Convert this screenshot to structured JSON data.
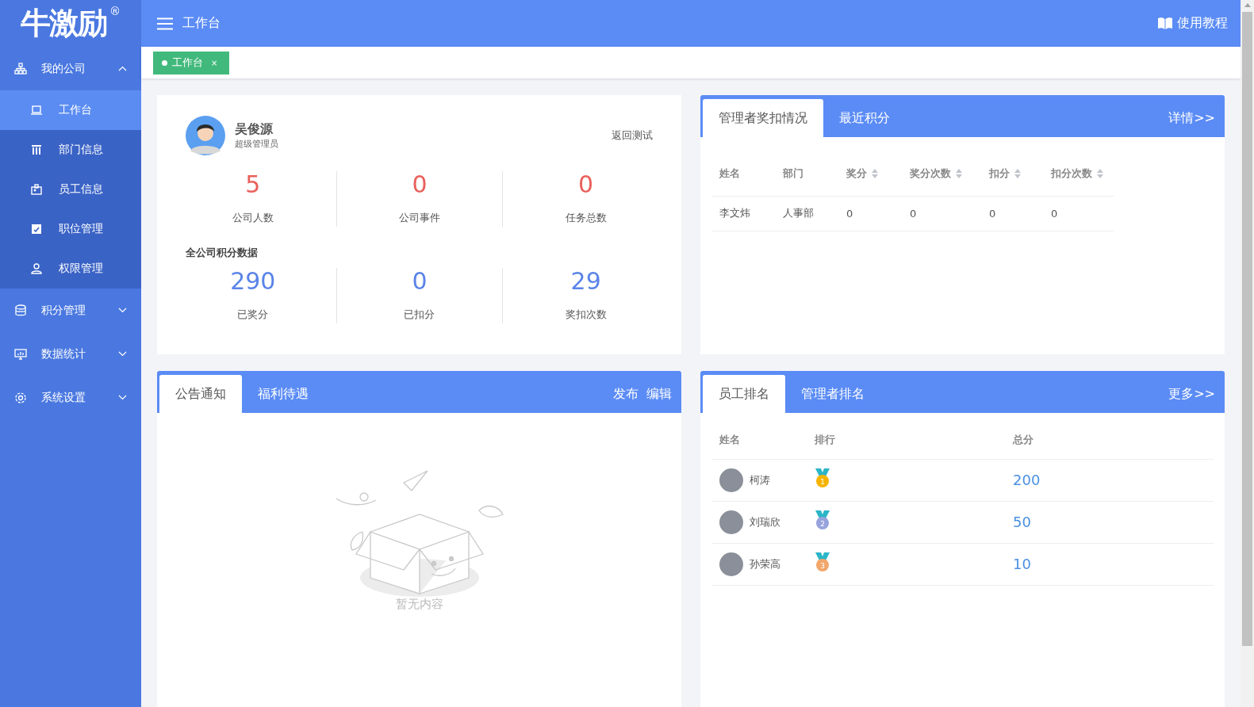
{
  "logo": {
    "text": "牛激励",
    "mark": "®"
  },
  "header": {
    "title": "工作台",
    "help": "使用教程"
  },
  "tags": [
    {
      "label": "工作台",
      "close": "×",
      "selected": true
    }
  ],
  "sidebar": {
    "items": [
      {
        "label": "我的公司",
        "expanded": true,
        "children": [
          {
            "label": "工作台",
            "selected": true
          },
          {
            "label": "部门信息",
            "selected": false
          },
          {
            "label": "员工信息",
            "selected": false
          },
          {
            "label": "职位管理",
            "selected": false
          },
          {
            "label": "权限管理",
            "selected": false
          }
        ]
      },
      {
        "label": "积分管理",
        "expanded": false
      },
      {
        "label": "数据统计",
        "expanded": false
      },
      {
        "label": "系统设置",
        "expanded": false
      }
    ]
  },
  "profile": {
    "name": "吴俊源",
    "role": "超级管理员",
    "link": "返回测试"
  },
  "company_stats": [
    {
      "value": "5",
      "label": "公司人数"
    },
    {
      "value": "0",
      "label": "公司事件"
    },
    {
      "value": "0",
      "label": "任务总数"
    }
  ],
  "points_title": "全公司积分数据",
  "points_stats": [
    {
      "value": "290",
      "label": "已奖分"
    },
    {
      "value": "0",
      "label": "已扣分"
    },
    {
      "value": "29",
      "label": "奖扣次数"
    }
  ],
  "manager_panel": {
    "tabs": [
      {
        "label": "管理者奖扣情况",
        "selected": true
      },
      {
        "label": "最近积分",
        "selected": false
      }
    ],
    "link": "详情>>",
    "columns": [
      {
        "label": "姓名",
        "sortable": false
      },
      {
        "label": "部门",
        "sortable": false
      },
      {
        "label": "奖分",
        "sortable": true
      },
      {
        "label": "奖分次数",
        "sortable": true
      },
      {
        "label": "扣分",
        "sortable": true
      },
      {
        "label": "扣分次数",
        "sortable": true
      }
    ],
    "rows": [
      [
        "李文炜",
        "人事部",
        "0",
        "0",
        "0",
        "0"
      ]
    ]
  },
  "notice_panel": {
    "tabs": [
      {
        "label": "公告通知",
        "selected": true
      },
      {
        "label": "福利待遇",
        "selected": false
      }
    ],
    "actions": [
      "发布",
      "编辑"
    ],
    "empty": "暂无内容"
  },
  "ranking_panel": {
    "tabs": [
      {
        "label": "员工排名",
        "selected": true
      },
      {
        "label": "管理者排名",
        "selected": false
      }
    ],
    "link": "更多>>",
    "columns": [
      "姓名",
      "排行",
      "总分"
    ],
    "rows": [
      {
        "name": "柯涛",
        "rank": "1",
        "color": "#f5b400",
        "score": "200"
      },
      {
        "name": "刘瑞欣",
        "rank": "2",
        "color": "#97a3dc",
        "score": "50"
      },
      {
        "name": "孙荣高",
        "rank": "3",
        "color": "#f2a66a",
        "score": "10"
      }
    ]
  }
}
